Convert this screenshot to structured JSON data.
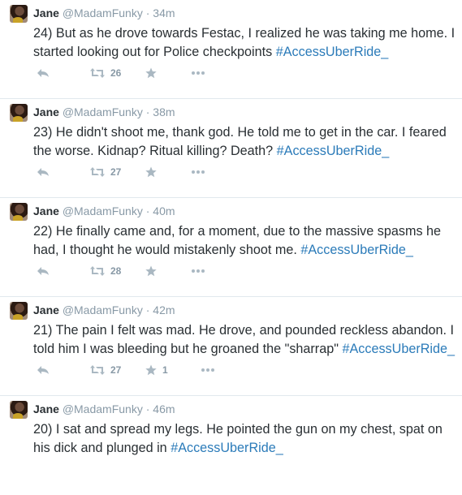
{
  "icons": {
    "reply": "reply-icon",
    "retweet": "retweet-icon",
    "favorite": "star-icon",
    "more": "more-dots-icon"
  },
  "colors": {
    "hashtag": "#2b7bb9",
    "meta": "#8899a6",
    "icon": "#aab8c2",
    "text": "#292f33"
  },
  "tweets": [
    {
      "name": "Jane",
      "handle": "@MadamFunky",
      "separator": "·",
      "time": "34m",
      "text": "24) But as he drove towards Festac, I realized he was taking me home. I started looking out for Police checkpoints ",
      "hashtag": "#AccessUberRide_",
      "retweets": "26",
      "favorites": ""
    },
    {
      "name": "Jane",
      "handle": "@MadamFunky",
      "separator": "·",
      "time": "38m",
      "text": "23) He didn't shoot me, thank god. He told me to get in the car. I feared the worse. Kidnap? Ritual killing? Death? ",
      "hashtag": "#AccessUberRide_",
      "retweets": "27",
      "favorites": ""
    },
    {
      "name": "Jane",
      "handle": "@MadamFunky",
      "separator": "·",
      "time": "40m",
      "text": "22) He finally came and, for a moment, due to the massive spasms he had, I thought he would mistakenly shoot me. ",
      "hashtag": "#AccessUberRide_",
      "retweets": "28",
      "favorites": ""
    },
    {
      "name": "Jane",
      "handle": "@MadamFunky",
      "separator": "·",
      "time": "42m",
      "text": "21) The pain I felt was mad. He drove, and pounded reckless abandon. I told him I was bleeding but he groaned the \"sharrap\" ",
      "hashtag": "#AccessUberRide_",
      "retweets": "27",
      "favorites": "1"
    },
    {
      "name": "Jane",
      "handle": "@MadamFunky",
      "separator": "·",
      "time": "46m",
      "text": "20) I sat and spread my legs. He pointed the gun on my chest, spat on his dick and plunged in ",
      "hashtag": "#AccessUberRide_",
      "retweets": "",
      "favorites": ""
    }
  ]
}
